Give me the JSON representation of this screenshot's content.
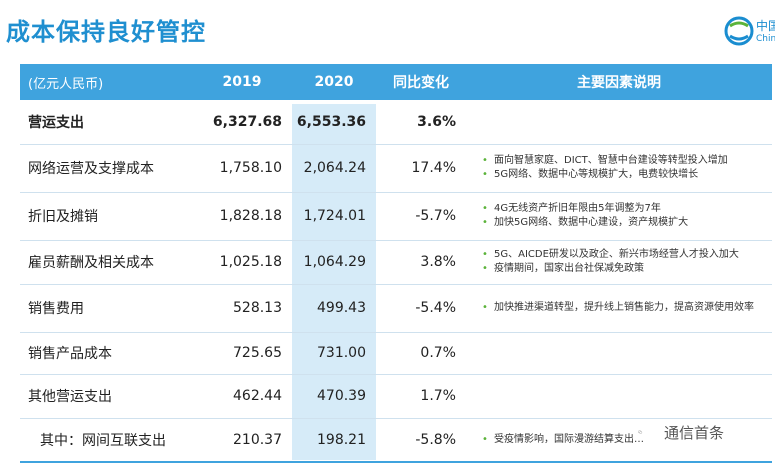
{
  "title": "成本保持良好管控",
  "logo": {
    "text": "中国",
    "sub": "Chin"
  },
  "table": {
    "headers": [
      "(亿元人民币)",
      "2019",
      "2020",
      "同比变化",
      "主要因素说明"
    ],
    "rows": [
      {
        "name": "营运支出",
        "v2019": "6,327.68",
        "v2020": "6,553.36",
        "change": "3.6%",
        "factors": []
      },
      {
        "name": "网络运营及支撑成本",
        "v2019": "1,758.10",
        "v2020": "2,064.24",
        "change": "17.4%",
        "factors": [
          "面向智慧家庭、DICT、智慧中台建设等转型投入增加",
          "5G网络、数据中心等规模扩大，电费较快增长"
        ]
      },
      {
        "name": "折旧及摊销",
        "v2019": "1,828.18",
        "v2020": "1,724.01",
        "change": "-5.7%",
        "factors": [
          "4G无线资产折旧年限由5年调整为7年",
          "加快5G网络、数据中心建设，资产规模扩大"
        ]
      },
      {
        "name": "雇员薪酬及相关成本",
        "v2019": "1,025.18",
        "v2020": "1,064.29",
        "change": "3.8%",
        "factors": [
          "5G、AICDE研发以及政企、新兴市场经营人才投入加大",
          "疫情期间，国家出台社保减免政策"
        ]
      },
      {
        "name": "销售费用",
        "v2019": "528.13",
        "v2020": "499.43",
        "change": "-5.4%",
        "factors": [
          "加快推进渠道转型，提升线上销售能力，提高资源使用效率"
        ]
      },
      {
        "name": "销售产品成本",
        "v2019": "725.65",
        "v2020": "731.00",
        "change": "0.7%",
        "factors": []
      },
      {
        "name": "其他营运支出",
        "v2019": "462.44",
        "v2020": "470.39",
        "change": "1.7%",
        "factors": []
      },
      {
        "name": "其中：网间互联支出",
        "v2019": "210.37",
        "v2020": "198.21",
        "change": "-5.8%",
        "factors": [
          "受疫情影响，国际漫游结算支出…"
        ]
      }
    ]
  },
  "watermark": "通信首条",
  "colors": {
    "accent": "#3fa3de",
    "title": "#1f8fd0",
    "highlight_col": "#d6ebf8",
    "bullet": "#5bb33a"
  }
}
